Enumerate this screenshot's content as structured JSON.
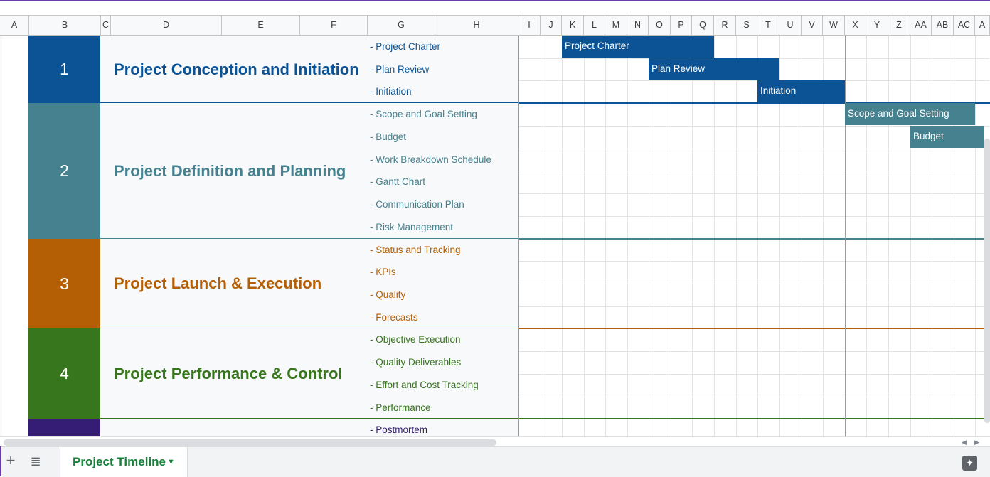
{
  "columns": [
    "A",
    "B",
    "C",
    "D",
    "E",
    "F",
    "G",
    "H",
    "I",
    "J",
    "K",
    "L",
    "M",
    "N",
    "O",
    "P",
    "Q",
    "R",
    "S",
    "T",
    "U",
    "V",
    "W",
    "X",
    "Y",
    "Z",
    "AA",
    "AB",
    "AC",
    "A"
  ],
  "phases": [
    {
      "number": "1",
      "title": "Project Conception and Initiation",
      "color": "#0b5394",
      "title_color": "#0b5394",
      "tasks": [
        "- Project Charter",
        "- Plan Review",
        "- Initiation"
      ]
    },
    {
      "number": "2",
      "title": "Project Definition and Planning",
      "color": "#45818e",
      "title_color": "#45818e",
      "tasks": [
        "- Scope and Goal Setting",
        "- Budget",
        "- Work Breakdown Schedule",
        "- Gantt Chart",
        "- Communication Plan",
        "- Risk Management"
      ]
    },
    {
      "number": "3",
      "title": "Project Launch & Execution",
      "color": "#b45f06",
      "title_color": "#b45f06",
      "tasks": [
        "- Status and Tracking",
        "- KPIs",
        "- Quality",
        "- Forecasts"
      ]
    },
    {
      "number": "4",
      "title": "Project Performance & Control",
      "color": "#38761d",
      "title_color": "#38761d",
      "tasks": [
        "- Objective Execution",
        "- Quality Deliverables",
        "- Effort and Cost Tracking",
        "- Performance"
      ]
    },
    {
      "number": "",
      "title": "",
      "color": "#351c75",
      "title_color": "#351c75",
      "tasks": [
        "- Postmortem"
      ]
    }
  ],
  "gantt_bars": [
    {
      "label": "Project Charter",
      "color": "#0b5394"
    },
    {
      "label": "Plan Review",
      "color": "#0b5394"
    },
    {
      "label": "Initiation",
      "color": "#0b5394"
    },
    {
      "label": "Scope and Goal Setting",
      "color": "#45818e"
    },
    {
      "label": "Budget",
      "color": "#45818e"
    }
  ],
  "sheet_tab": {
    "label": "Project Timeline"
  },
  "icons": {
    "add": "plus-icon",
    "all_sheets": "list-icon",
    "caret": "caret-down-icon",
    "explore": "explore-icon"
  }
}
